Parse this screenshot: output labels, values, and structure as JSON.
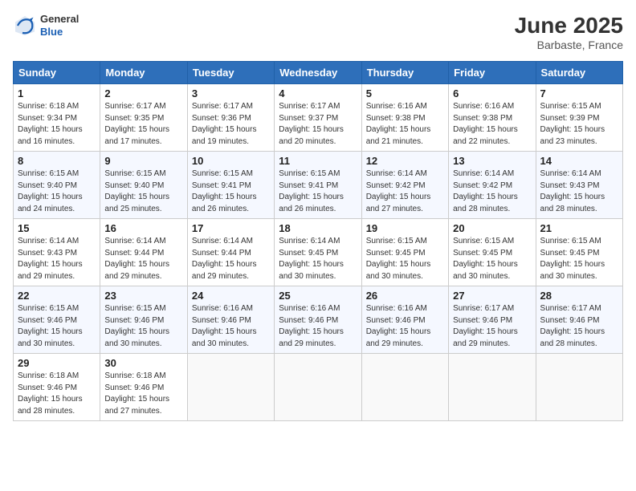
{
  "header": {
    "logo_general": "General",
    "logo_blue": "Blue",
    "month_title": "June 2025",
    "location": "Barbaste, France"
  },
  "columns": [
    "Sunday",
    "Monday",
    "Tuesday",
    "Wednesday",
    "Thursday",
    "Friday",
    "Saturday"
  ],
  "weeks": [
    [
      {
        "day": "1",
        "sunrise": "Sunrise: 6:18 AM",
        "sunset": "Sunset: 9:34 PM",
        "daylight": "Daylight: 15 hours and 16 minutes."
      },
      {
        "day": "2",
        "sunrise": "Sunrise: 6:17 AM",
        "sunset": "Sunset: 9:35 PM",
        "daylight": "Daylight: 15 hours and 17 minutes."
      },
      {
        "day": "3",
        "sunrise": "Sunrise: 6:17 AM",
        "sunset": "Sunset: 9:36 PM",
        "daylight": "Daylight: 15 hours and 19 minutes."
      },
      {
        "day": "4",
        "sunrise": "Sunrise: 6:17 AM",
        "sunset": "Sunset: 9:37 PM",
        "daylight": "Daylight: 15 hours and 20 minutes."
      },
      {
        "day": "5",
        "sunrise": "Sunrise: 6:16 AM",
        "sunset": "Sunset: 9:38 PM",
        "daylight": "Daylight: 15 hours and 21 minutes."
      },
      {
        "day": "6",
        "sunrise": "Sunrise: 6:16 AM",
        "sunset": "Sunset: 9:38 PM",
        "daylight": "Daylight: 15 hours and 22 minutes."
      },
      {
        "day": "7",
        "sunrise": "Sunrise: 6:15 AM",
        "sunset": "Sunset: 9:39 PM",
        "daylight": "Daylight: 15 hours and 23 minutes."
      }
    ],
    [
      {
        "day": "8",
        "sunrise": "Sunrise: 6:15 AM",
        "sunset": "Sunset: 9:40 PM",
        "daylight": "Daylight: 15 hours and 24 minutes."
      },
      {
        "day": "9",
        "sunrise": "Sunrise: 6:15 AM",
        "sunset": "Sunset: 9:40 PM",
        "daylight": "Daylight: 15 hours and 25 minutes."
      },
      {
        "day": "10",
        "sunrise": "Sunrise: 6:15 AM",
        "sunset": "Sunset: 9:41 PM",
        "daylight": "Daylight: 15 hours and 26 minutes."
      },
      {
        "day": "11",
        "sunrise": "Sunrise: 6:15 AM",
        "sunset": "Sunset: 9:41 PM",
        "daylight": "Daylight: 15 hours and 26 minutes."
      },
      {
        "day": "12",
        "sunrise": "Sunrise: 6:14 AM",
        "sunset": "Sunset: 9:42 PM",
        "daylight": "Daylight: 15 hours and 27 minutes."
      },
      {
        "day": "13",
        "sunrise": "Sunrise: 6:14 AM",
        "sunset": "Sunset: 9:42 PM",
        "daylight": "Daylight: 15 hours and 28 minutes."
      },
      {
        "day": "14",
        "sunrise": "Sunrise: 6:14 AM",
        "sunset": "Sunset: 9:43 PM",
        "daylight": "Daylight: 15 hours and 28 minutes."
      }
    ],
    [
      {
        "day": "15",
        "sunrise": "Sunrise: 6:14 AM",
        "sunset": "Sunset: 9:43 PM",
        "daylight": "Daylight: 15 hours and 29 minutes."
      },
      {
        "day": "16",
        "sunrise": "Sunrise: 6:14 AM",
        "sunset": "Sunset: 9:44 PM",
        "daylight": "Daylight: 15 hours and 29 minutes."
      },
      {
        "day": "17",
        "sunrise": "Sunrise: 6:14 AM",
        "sunset": "Sunset: 9:44 PM",
        "daylight": "Daylight: 15 hours and 29 minutes."
      },
      {
        "day": "18",
        "sunrise": "Sunrise: 6:14 AM",
        "sunset": "Sunset: 9:45 PM",
        "daylight": "Daylight: 15 hours and 30 minutes."
      },
      {
        "day": "19",
        "sunrise": "Sunrise: 6:15 AM",
        "sunset": "Sunset: 9:45 PM",
        "daylight": "Daylight: 15 hours and 30 minutes."
      },
      {
        "day": "20",
        "sunrise": "Sunrise: 6:15 AM",
        "sunset": "Sunset: 9:45 PM",
        "daylight": "Daylight: 15 hours and 30 minutes."
      },
      {
        "day": "21",
        "sunrise": "Sunrise: 6:15 AM",
        "sunset": "Sunset: 9:45 PM",
        "daylight": "Daylight: 15 hours and 30 minutes."
      }
    ],
    [
      {
        "day": "22",
        "sunrise": "Sunrise: 6:15 AM",
        "sunset": "Sunset: 9:46 PM",
        "daylight": "Daylight: 15 hours and 30 minutes."
      },
      {
        "day": "23",
        "sunrise": "Sunrise: 6:15 AM",
        "sunset": "Sunset: 9:46 PM",
        "daylight": "Daylight: 15 hours and 30 minutes."
      },
      {
        "day": "24",
        "sunrise": "Sunrise: 6:16 AM",
        "sunset": "Sunset: 9:46 PM",
        "daylight": "Daylight: 15 hours and 30 minutes."
      },
      {
        "day": "25",
        "sunrise": "Sunrise: 6:16 AM",
        "sunset": "Sunset: 9:46 PM",
        "daylight": "Daylight: 15 hours and 29 minutes."
      },
      {
        "day": "26",
        "sunrise": "Sunrise: 6:16 AM",
        "sunset": "Sunset: 9:46 PM",
        "daylight": "Daylight: 15 hours and 29 minutes."
      },
      {
        "day": "27",
        "sunrise": "Sunrise: 6:17 AM",
        "sunset": "Sunset: 9:46 PM",
        "daylight": "Daylight: 15 hours and 29 minutes."
      },
      {
        "day": "28",
        "sunrise": "Sunrise: 6:17 AM",
        "sunset": "Sunset: 9:46 PM",
        "daylight": "Daylight: 15 hours and 28 minutes."
      }
    ],
    [
      {
        "day": "29",
        "sunrise": "Sunrise: 6:18 AM",
        "sunset": "Sunset: 9:46 PM",
        "daylight": "Daylight: 15 hours and 28 minutes."
      },
      {
        "day": "30",
        "sunrise": "Sunrise: 6:18 AM",
        "sunset": "Sunset: 9:46 PM",
        "daylight": "Daylight: 15 hours and 27 minutes."
      },
      null,
      null,
      null,
      null,
      null
    ]
  ]
}
